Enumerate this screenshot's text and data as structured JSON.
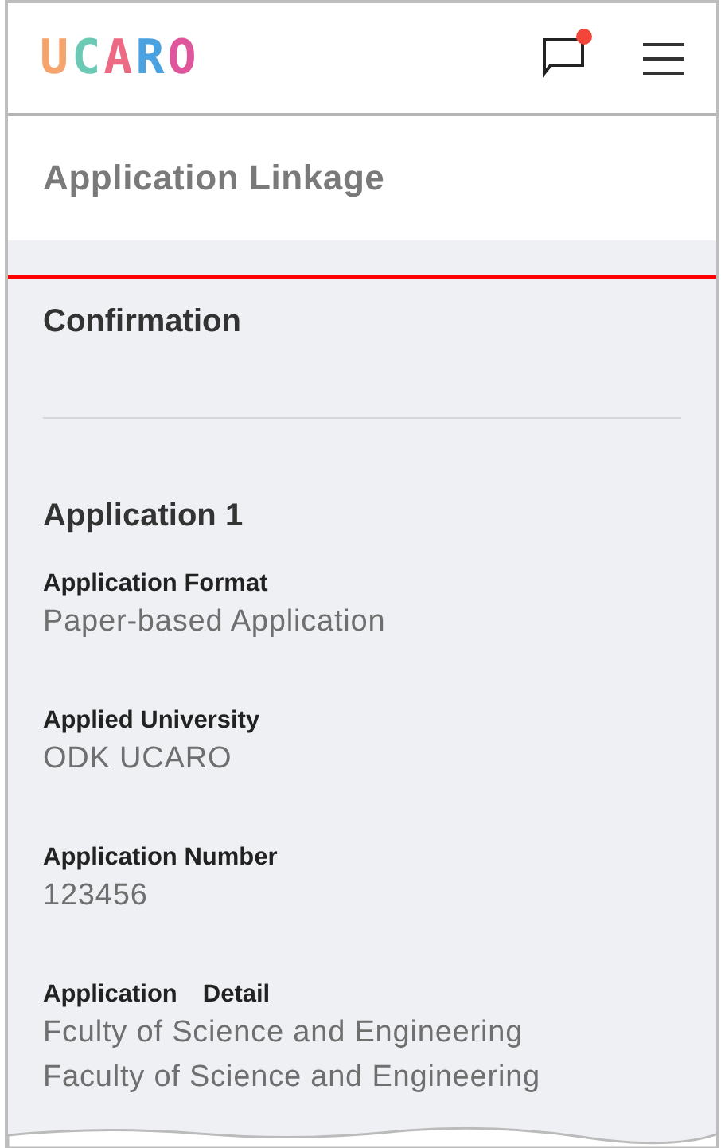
{
  "header": {
    "logo_letters": [
      {
        "char": "U",
        "color": "#f4a46c"
      },
      {
        "char": "C",
        "color": "#6cc9b4"
      },
      {
        "char": "A",
        "color": "#ec6a84"
      },
      {
        "char": "R",
        "color": "#4aa3e0"
      },
      {
        "char": "O",
        "color": "#e0569c"
      }
    ],
    "notification_unread": true
  },
  "page_title": "Application Linkage",
  "section": {
    "highlighted": true,
    "title": "Confirmation",
    "subtitle": "Application 1",
    "fields": [
      {
        "label": "Application Format",
        "values": [
          "Paper-based Application"
        ]
      },
      {
        "label": "Applied University",
        "values": [
          "ODK UCARO"
        ]
      },
      {
        "label": "Application Number",
        "values": [
          "123456"
        ]
      },
      {
        "label": "Application　Detail",
        "values": [
          "Fculty of Science and Engineering",
          "Faculty of Science and Engineering"
        ]
      }
    ]
  }
}
